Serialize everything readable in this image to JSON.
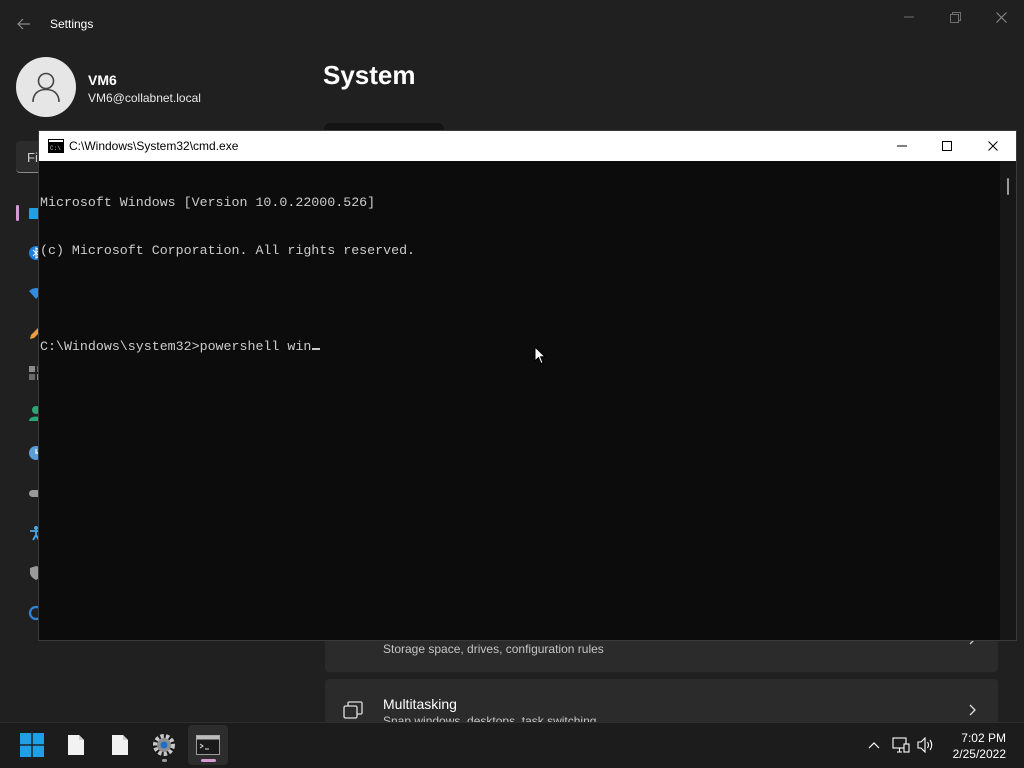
{
  "settings": {
    "window_title": "Settings",
    "user": {
      "name": "VM6",
      "email": "VM6@collabnet.local"
    },
    "search": {
      "partial_text": "Fi"
    },
    "page_title": "System",
    "nav_icons": [
      "display-icon",
      "bluetooth-icon",
      "wifi-icon",
      "pen-icon",
      "apps-icon",
      "accounts-icon",
      "time-language-icon",
      "gaming-icon",
      "accessibility-icon",
      "privacy-shield-icon",
      "windows-update-icon"
    ],
    "cards": [
      {
        "title": "",
        "subtitle": "Storage space, drives, configuration rules",
        "icon": "storage-icon"
      },
      {
        "title": "Multitasking",
        "subtitle": "Snap windows, desktops, task switching",
        "icon": "multitasking-icon"
      }
    ]
  },
  "cmd": {
    "window_title": "C:\\Windows\\System32\\cmd.exe",
    "lines": [
      "Microsoft Windows [Version 10.0.22000.526]",
      "(c) Microsoft Corporation. All rights reserved.",
      "",
      "C:\\Windows\\system32>powershell win"
    ]
  },
  "taskbar": {
    "apps": [
      {
        "name": "start-button",
        "icon": "windows-logo-icon"
      },
      {
        "name": "file-app-1",
        "icon": "document-icon"
      },
      {
        "name": "file-app-2",
        "icon": "document-icon"
      },
      {
        "name": "settings-app",
        "icon": "gear-icon"
      },
      {
        "name": "cmd-app",
        "icon": "terminal-icon"
      }
    ],
    "tray_icons": [
      "chevron-up-icon",
      "network-icon",
      "volume-icon"
    ],
    "time": "7:02 PM",
    "date": "2/25/2022"
  },
  "colors": {
    "accent": "#d89ad6",
    "console_bg": "#0c0c0c",
    "console_text": "#cccccc",
    "settings_bg": "#202020",
    "windows_blue": "#1fa0e6"
  }
}
